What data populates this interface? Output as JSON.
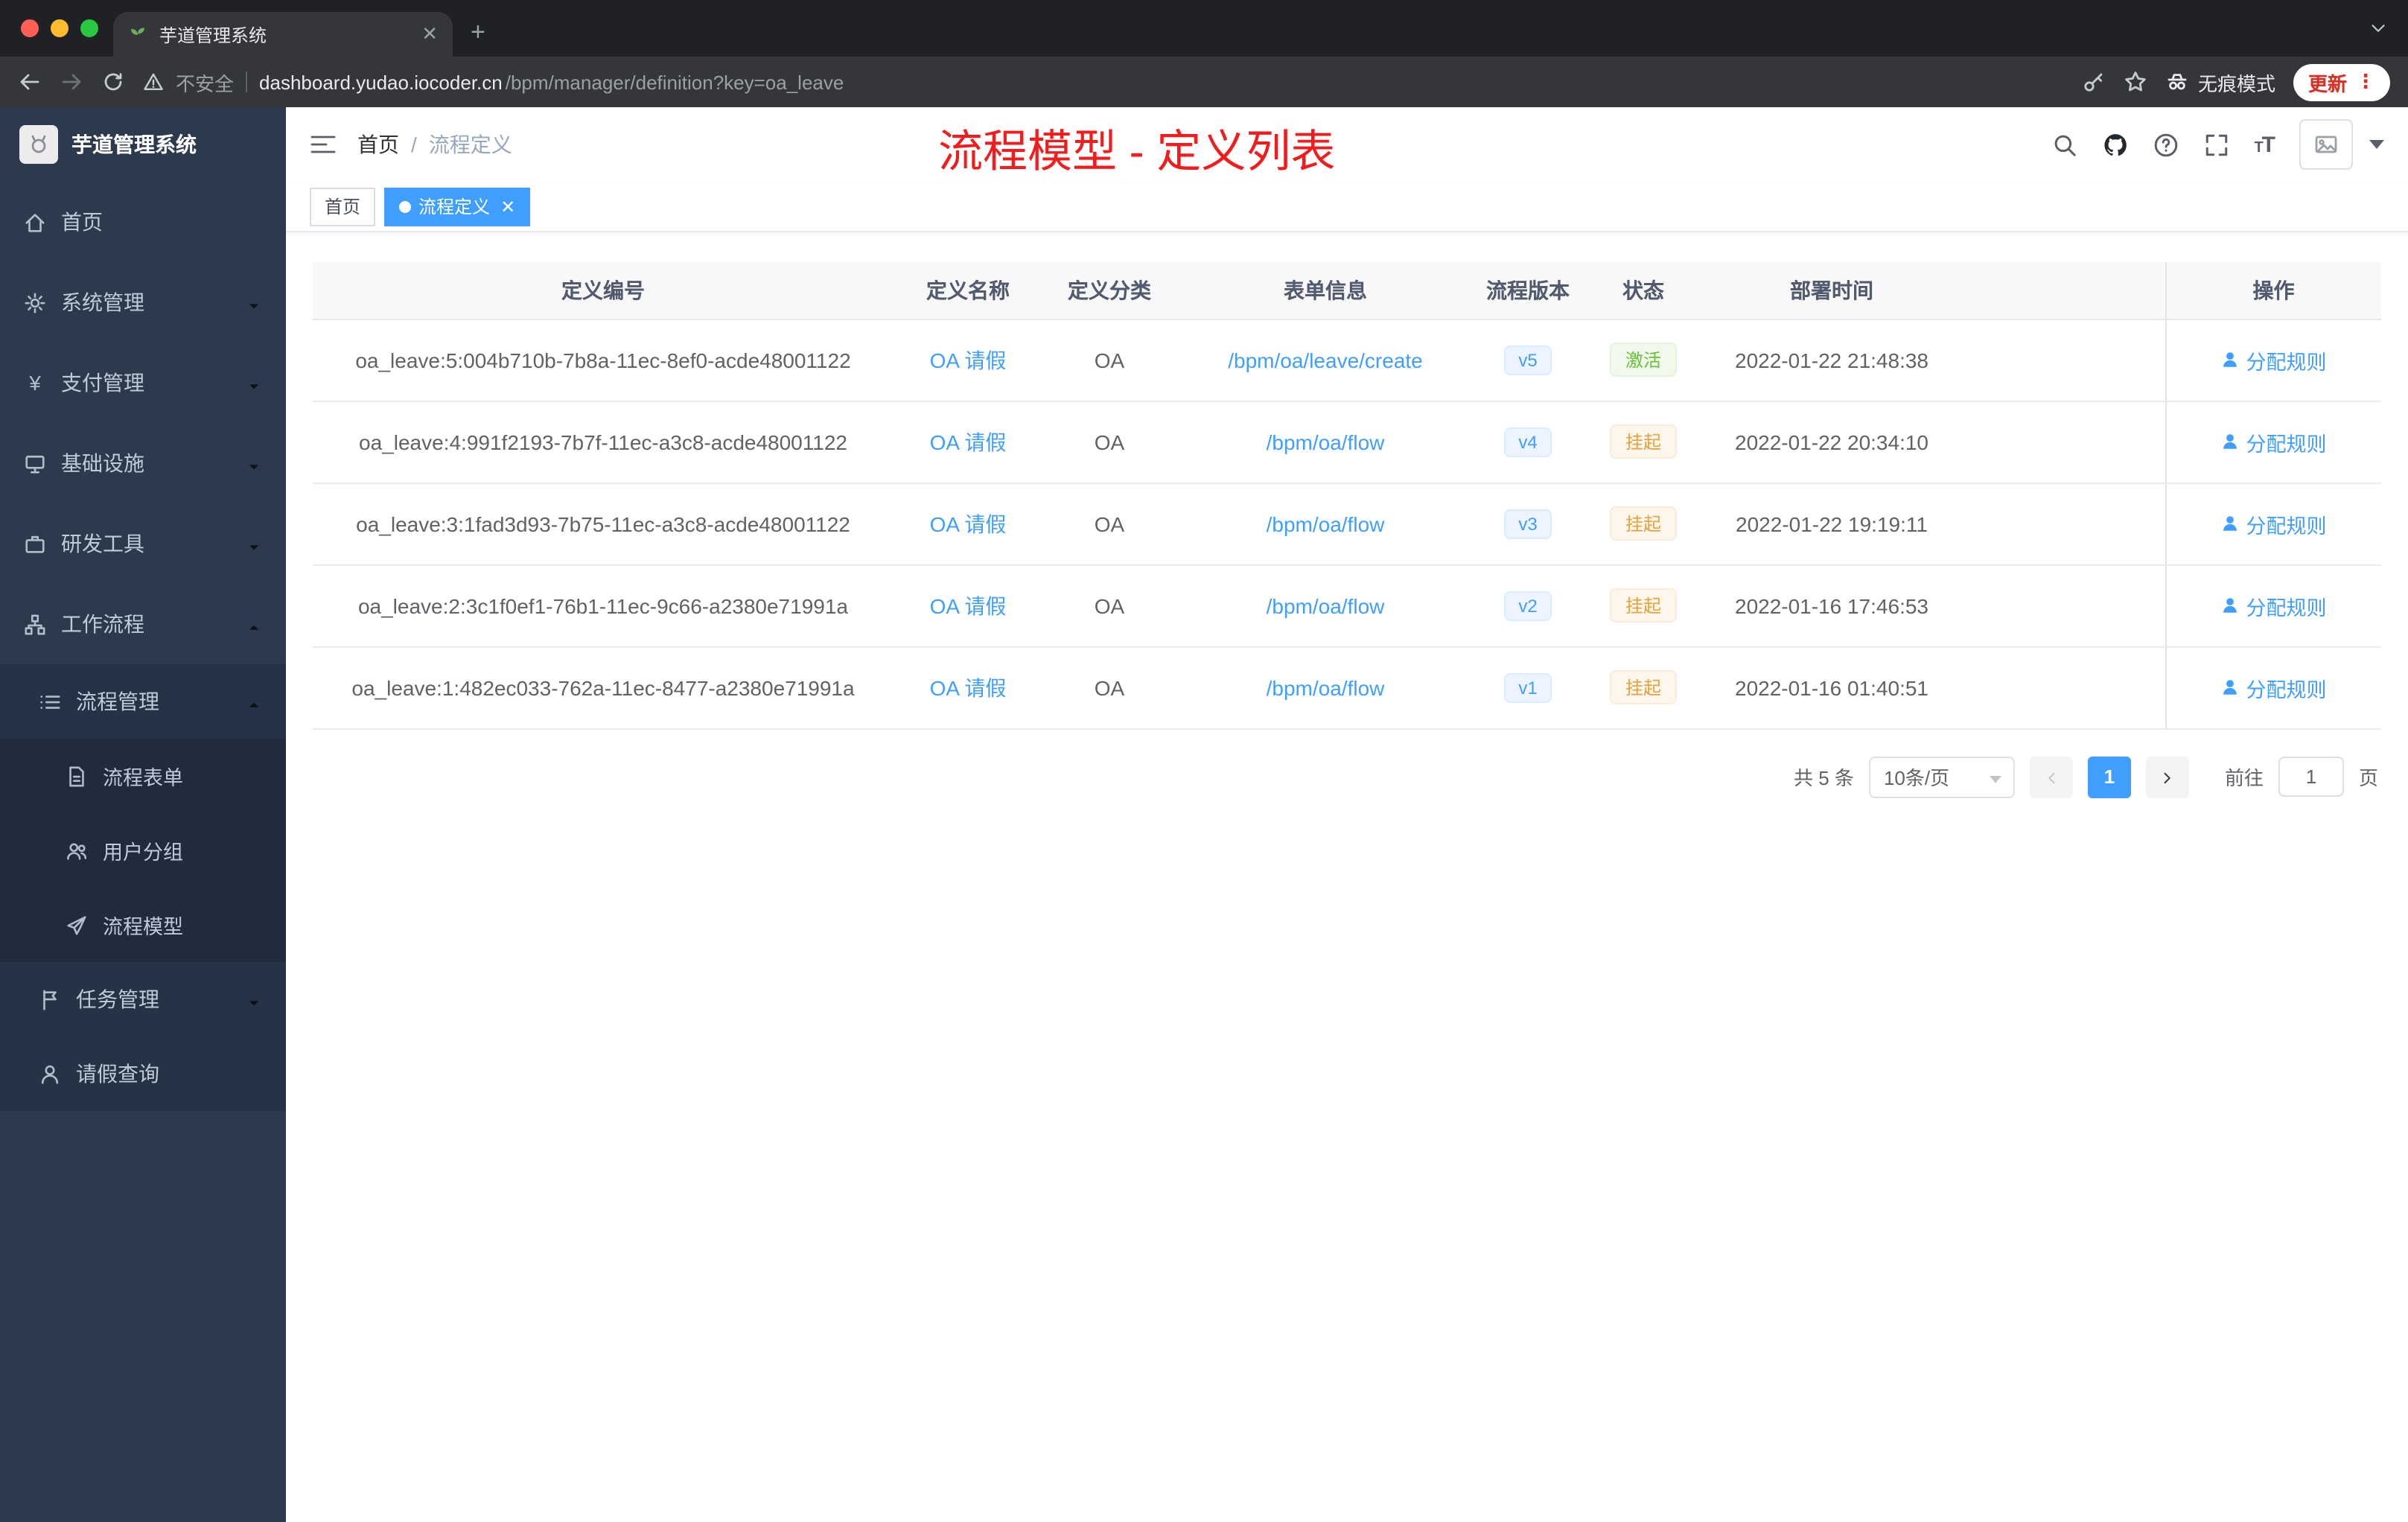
{
  "browser": {
    "tab": {
      "title": "芋道管理系统"
    },
    "toolbar": {
      "security_label": "不安全",
      "url_host": "dashboard.yudao.iocoder.cn",
      "url_path": "/bpm/manager/definition?key=oa_leave",
      "incognito_label": "无痕模式",
      "update_label": "更新"
    }
  },
  "sidebar": {
    "logo_title": "芋道管理系统",
    "items": [
      {
        "label": "首页",
        "icon": "home-icon"
      },
      {
        "label": "系统管理",
        "icon": "gear-icon"
      },
      {
        "label": "支付管理",
        "icon": "yen-icon"
      },
      {
        "label": "基础设施",
        "icon": "monitor-icon"
      },
      {
        "label": "研发工具",
        "icon": "briefcase-icon"
      },
      {
        "label": "工作流程",
        "icon": "workflow-icon"
      },
      {
        "label": "流程管理",
        "icon": "list-icon"
      },
      {
        "label": "流程表单",
        "icon": "document-icon"
      },
      {
        "label": "用户分组",
        "icon": "users-icon"
      },
      {
        "label": "流程模型",
        "icon": "send-icon"
      },
      {
        "label": "任务管理",
        "icon": "flag-icon"
      },
      {
        "label": "请假查询",
        "icon": "user-icon"
      }
    ]
  },
  "header": {
    "breadcrumb_home": "首页",
    "breadcrumb_separator": "/",
    "breadcrumb_current": "流程定义",
    "annotation": "流程模型 - 定义列表"
  },
  "tags": [
    {
      "label": "首页",
      "active": false
    },
    {
      "label": "流程定义",
      "active": true
    }
  ],
  "table": {
    "columns": [
      "定义编号",
      "定义名称",
      "定义分类",
      "表单信息",
      "流程版本",
      "状态",
      "部署时间",
      "操作"
    ],
    "rows": [
      {
        "id": "oa_leave:5:004b710b-7b8a-11ec-8ef0-acde48001122",
        "name": "OA 请假",
        "category": "OA",
        "form": "/bpm/oa/leave/create",
        "version": "v5",
        "status": "激活",
        "deploy_time": "2022-01-22 21:48:38",
        "action": "分配规则"
      },
      {
        "id": "oa_leave:4:991f2193-7b7f-11ec-a3c8-acde48001122",
        "name": "OA 请假",
        "category": "OA",
        "form": "/bpm/oa/flow",
        "version": "v4",
        "status": "挂起",
        "deploy_time": "2022-01-22 20:34:10",
        "action": "分配规则"
      },
      {
        "id": "oa_leave:3:1fad3d93-7b75-11ec-a3c8-acde48001122",
        "name": "OA 请假",
        "category": "OA",
        "form": "/bpm/oa/flow",
        "version": "v3",
        "status": "挂起",
        "deploy_time": "2022-01-22 19:19:11",
        "action": "分配规则"
      },
      {
        "id": "oa_leave:2:3c1f0ef1-76b1-11ec-9c66-a2380e71991a",
        "name": "OA 请假",
        "category": "OA",
        "form": "/bpm/oa/flow",
        "version": "v2",
        "status": "挂起",
        "deploy_time": "2022-01-16 17:46:53",
        "action": "分配规则"
      },
      {
        "id": "oa_leave:1:482ec033-762a-11ec-8477-a2380e71991a",
        "name": "OA 请假",
        "category": "OA",
        "form": "/bpm/oa/flow",
        "version": "v1",
        "status": "挂起",
        "deploy_time": "2022-01-16 01:40:51",
        "action": "分配规则"
      }
    ]
  },
  "pagination": {
    "total": "共 5 条",
    "page_size": "10条/页",
    "current_page": "1",
    "goto_label": "前往",
    "goto_value": "1",
    "unit_label": "页"
  },
  "colors": {
    "primary": "#409eff",
    "success": "#67c23a",
    "warning": "#e6a23c",
    "annotation_red": "#f21c1c",
    "sidebar_bg": "#2d3a4e"
  }
}
